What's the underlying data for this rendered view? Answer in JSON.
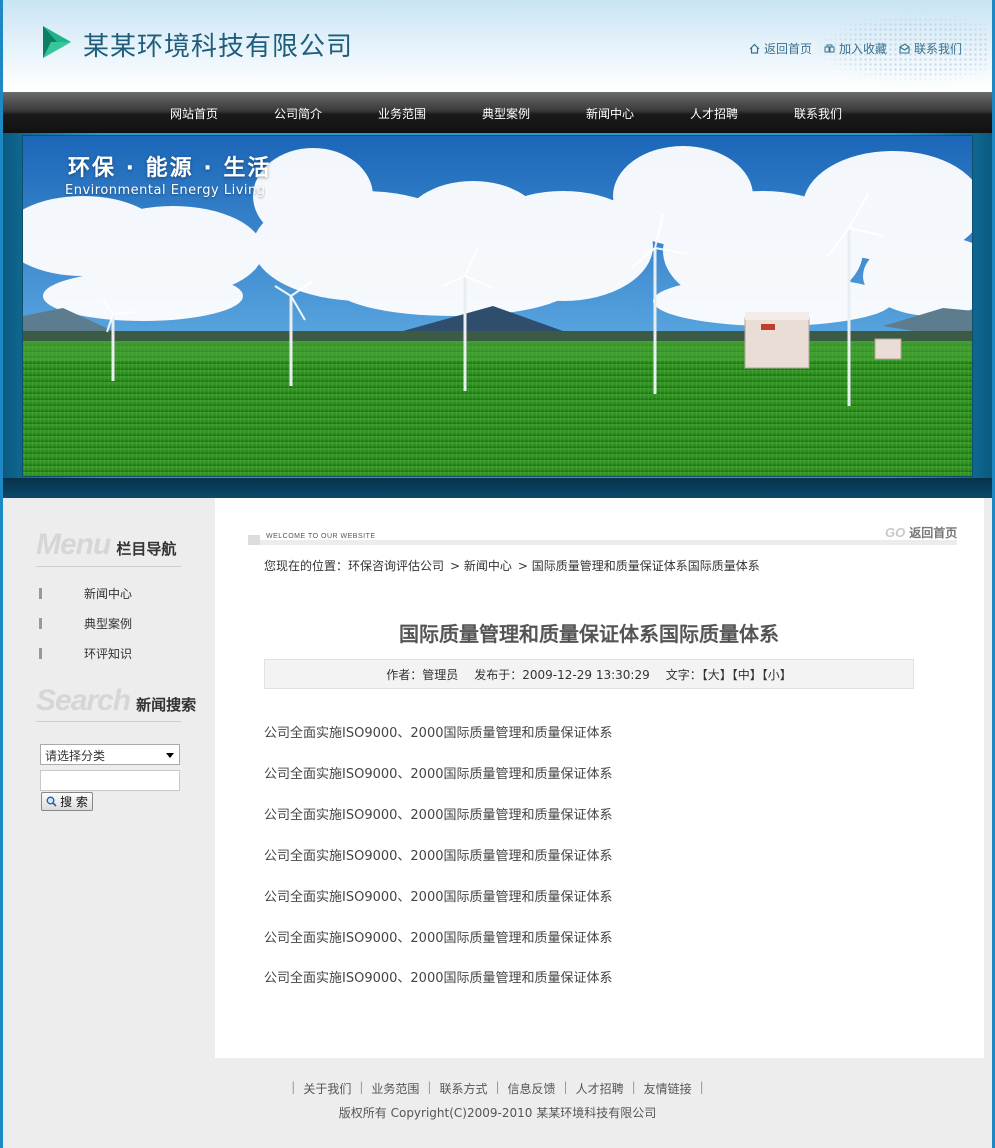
{
  "header": {
    "company_name": "某某环境科技有限公司",
    "links": [
      {
        "label": "返回首页",
        "icon": "home-icon"
      },
      {
        "label": "加入收藏",
        "icon": "favorite-icon"
      },
      {
        "label": "联系我们",
        "icon": "contact-icon"
      }
    ]
  },
  "nav": {
    "items": [
      "网站首页",
      "公司简介",
      "业务范围",
      "典型案例",
      "新闻中心",
      "人才招聘",
      "联系我们"
    ]
  },
  "banner": {
    "slogan_cn": "环保 · 能源 · 生活",
    "slogan_en": "Environmental  Energy  Living"
  },
  "sidebar": {
    "menu_en": "Menu",
    "menu_cn": "栏目导航",
    "items": [
      "新闻中心",
      "典型案例",
      "环评知识"
    ],
    "search_en": "Search",
    "search_cn": "新闻搜索",
    "select_value": "请选择分类",
    "search_button": "搜 索"
  },
  "main": {
    "welcome": "WELCOME TO OUR WEBSITE",
    "go": "GO",
    "back_home": "返回首页",
    "breadcrumb": [
      "您现在的位置：环保咨询评估公司",
      "> 新闻中心",
      "> 国际质量管理和质量保证体系国际质量体系"
    ],
    "title": "国际质量管理和质量保证体系国际质量体系",
    "meta": {
      "author": "作者：管理员",
      "published": "发布于：2009-12-29 13:30:29",
      "font_size": "文字：【大】【中】【小】"
    },
    "paragraphs": [
      "公司全面实施ISO9000、2000国际质量管理和质量保证体系",
      "公司全面实施ISO9000、2000国际质量管理和质量保证体系",
      "公司全面实施ISO9000、2000国际质量管理和质量保证体系",
      "公司全面实施ISO9000、2000国际质量管理和质量保证体系",
      "公司全面实施ISO9000、2000国际质量管理和质量保证体系",
      "公司全面实施ISO9000、2000国际质量管理和质量保证体系",
      "公司全面实施ISO9000、2000国际质量管理和质量保证体系"
    ]
  },
  "footer": {
    "links": [
      "关于我们",
      "业务范围",
      "联系方式",
      "信息反馈",
      "人才招聘",
      "友情链接"
    ],
    "copyright": "版权所有  Copyright(C)2009-2010 某某环境科技有限公司"
  },
  "colors": {
    "frame_blue": "#1e88c4",
    "logo_green": "#1fb38a",
    "company_text": "#1f5d7a",
    "nav_dark": "#1a1a1a"
  }
}
